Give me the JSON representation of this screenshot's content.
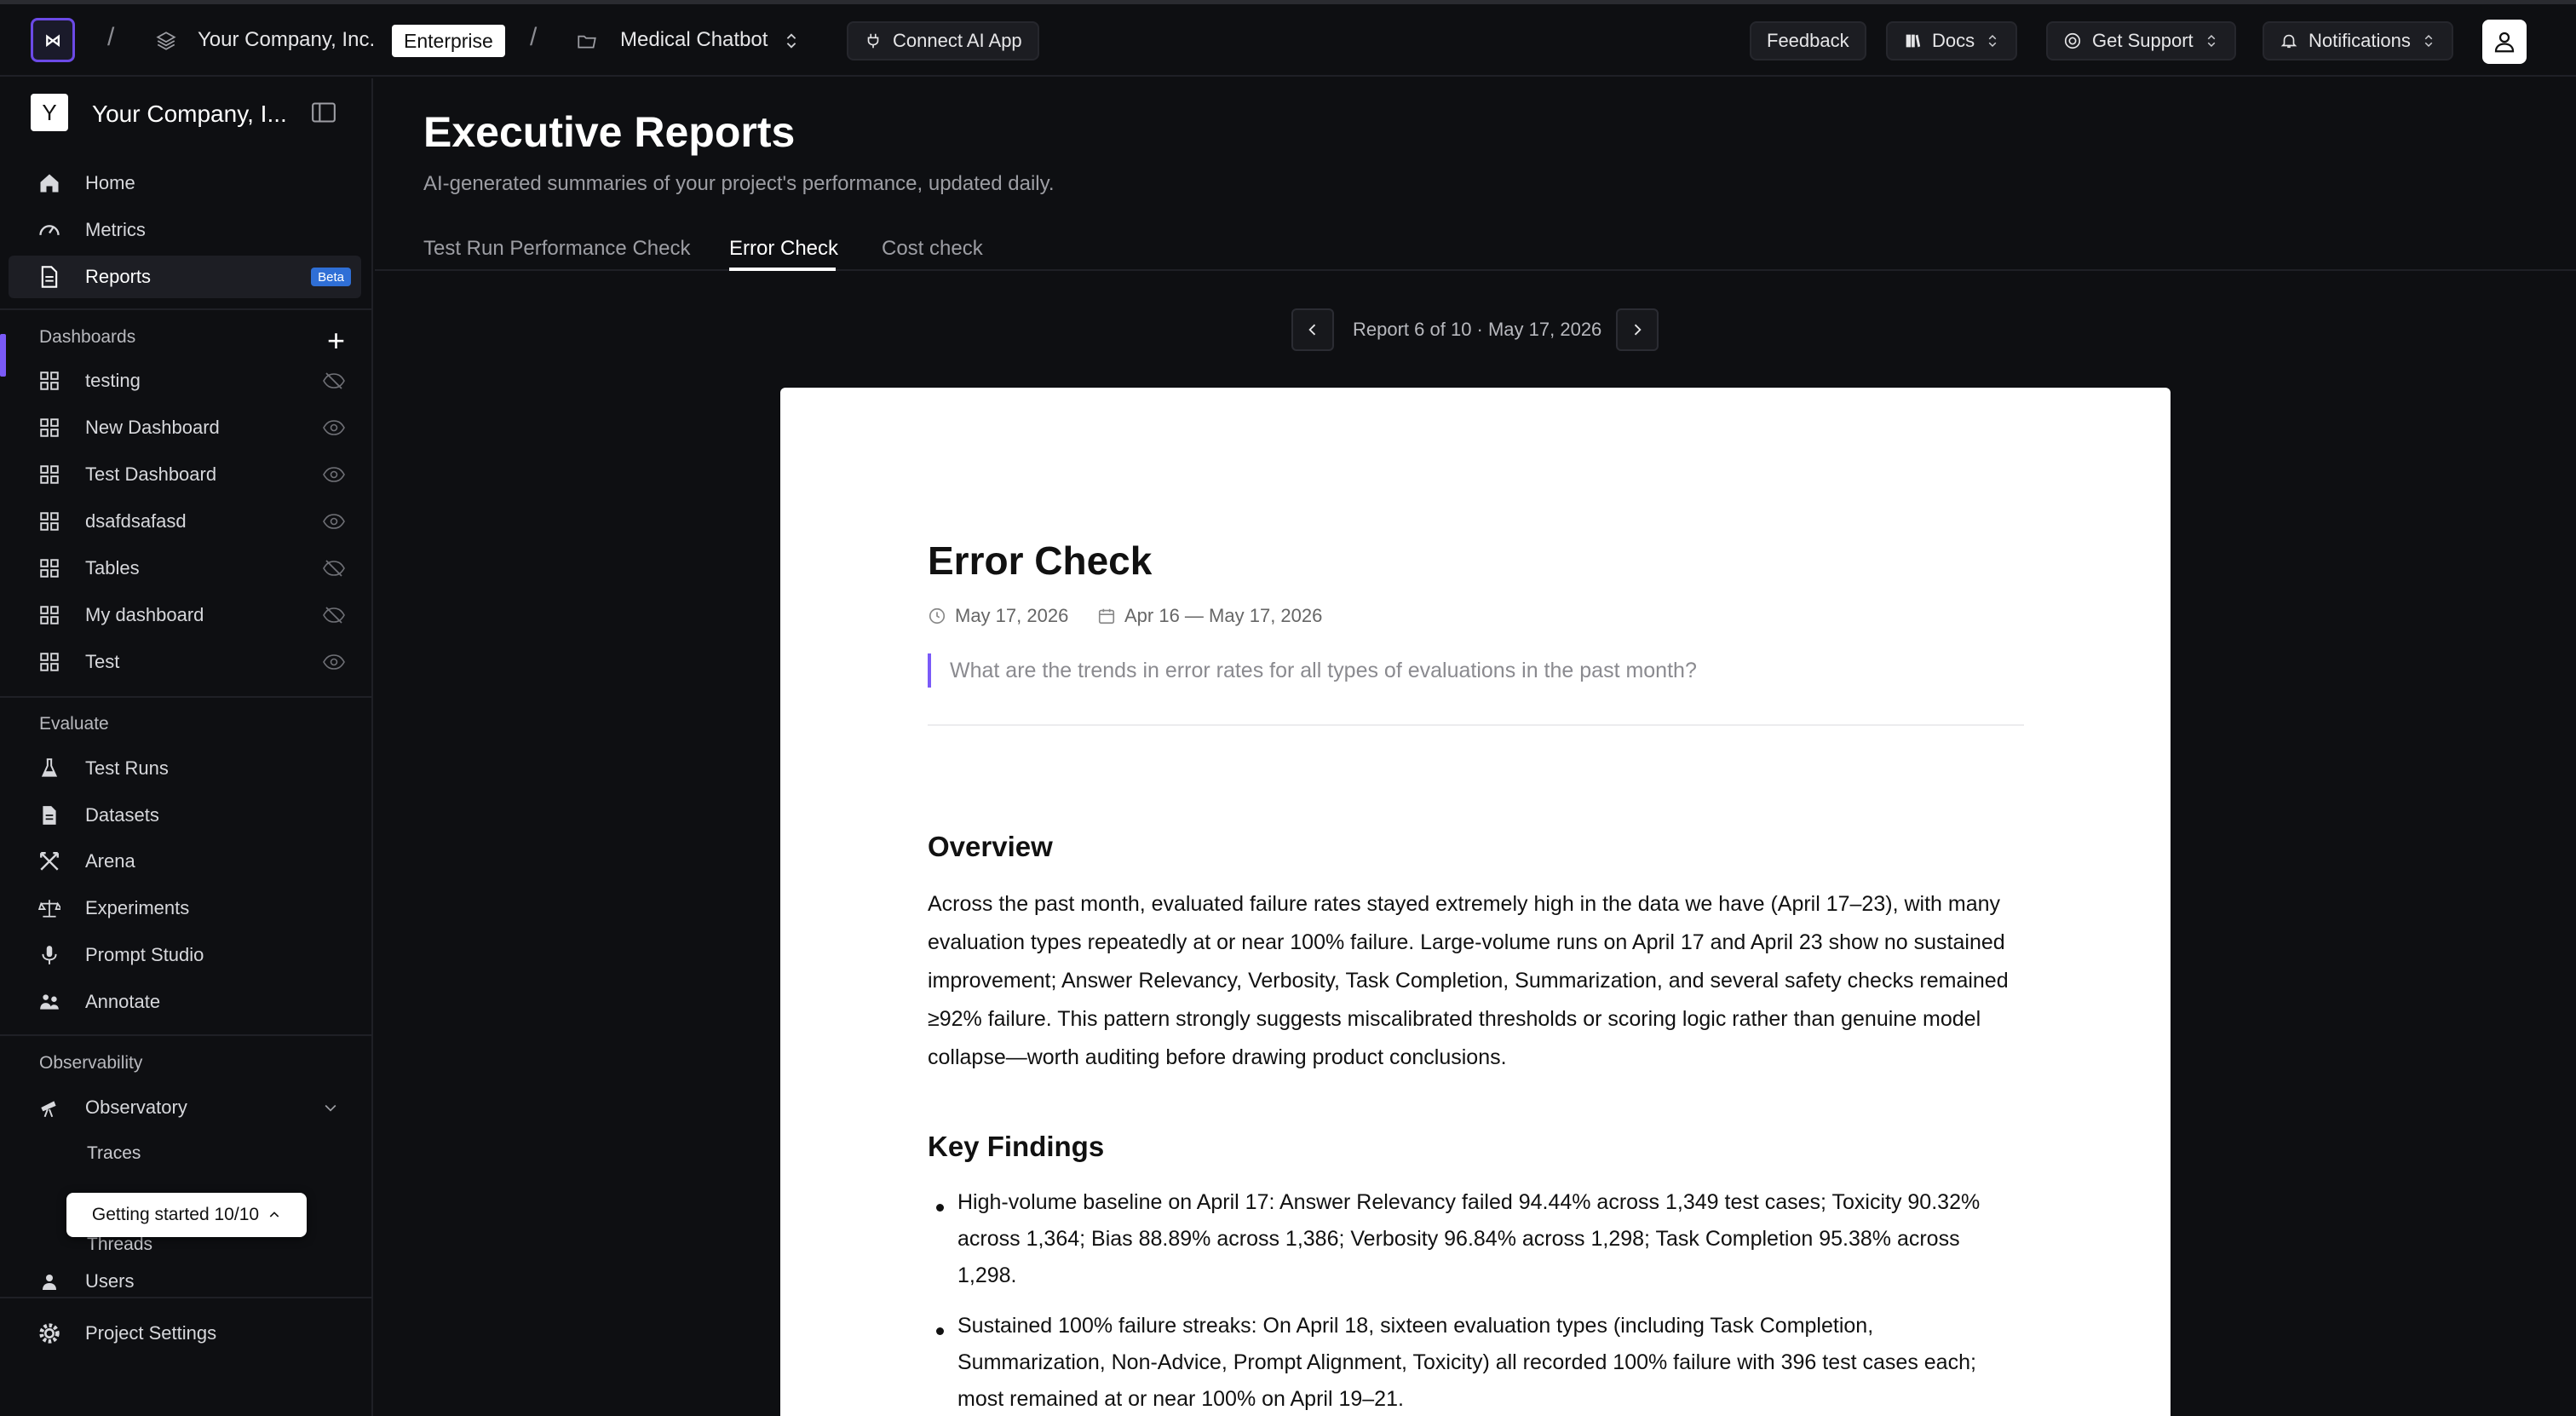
{
  "topbar": {
    "logo_text": "⋈",
    "org_name": "Your Company, Inc.",
    "plan_badge": "Enterprise",
    "project_name": "Medical Chatbot",
    "connect_label": "Connect AI App",
    "feedback_label": "Feedback",
    "docs_label": "Docs",
    "support_label": "Get Support",
    "notifications_label": "Notifications"
  },
  "sidebar": {
    "workspace_initial": "Y",
    "workspace_name": "Your Company, I...",
    "main_items": [
      {
        "label": "Home",
        "icon": "home-icon"
      },
      {
        "label": "Metrics",
        "icon": "gauge-icon"
      },
      {
        "label": "Reports",
        "icon": "document-icon",
        "badge": "Beta"
      }
    ],
    "dashboards_label": "Dashboards",
    "dashboards": [
      {
        "label": "testing",
        "visibility": "hidden"
      },
      {
        "label": "New Dashboard",
        "visibility": "visible"
      },
      {
        "label": "Test Dashboard",
        "visibility": "visible"
      },
      {
        "label": "dsafdsafasd",
        "visibility": "visible"
      },
      {
        "label": "Tables",
        "visibility": "hidden"
      },
      {
        "label": "My dashboard",
        "visibility": "hidden"
      },
      {
        "label": "Test",
        "visibility": "visible"
      }
    ],
    "evaluate_label": "Evaluate",
    "evaluate_items": [
      {
        "label": "Test Runs",
        "icon": "flask-icon"
      },
      {
        "label": "Datasets",
        "icon": "file-icon"
      },
      {
        "label": "Arena",
        "icon": "swords-icon"
      },
      {
        "label": "Experiments",
        "icon": "scale-icon"
      },
      {
        "label": "Prompt Studio",
        "icon": "mic-icon"
      },
      {
        "label": "Annotate",
        "icon": "users-icon"
      }
    ],
    "observability_label": "Observability",
    "observatory_label": "Observatory",
    "observatory_sub": [
      "Traces",
      "Threads",
      "Users"
    ],
    "getting_started": "Getting started 10/10",
    "settings_label": "Project Settings"
  },
  "main": {
    "title": "Executive Reports",
    "subtitle": "AI-generated summaries of your project's performance, updated daily.",
    "tabs": [
      {
        "label": "Test Run Performance Check"
      },
      {
        "label": "Error Check"
      },
      {
        "label": "Cost check"
      }
    ],
    "pager_text": "Report 6 of 10 · May 17, 2026"
  },
  "report": {
    "title": "Error Check",
    "date": "May 17, 2026",
    "range": "Apr 16 — May 17, 2026",
    "question": "What are the trends in error rates for all types of evaluations in the past month?",
    "overview_heading": "Overview",
    "overview_text": "Across the past month, evaluated failure rates stayed extremely high in the data we have (April 17–23), with many evaluation types repeatedly at or near 100% failure. Large-volume runs on April 17 and April 23 show no sustained improvement; Answer Relevancy, Verbosity, Task Completion, Summarization, and several safety checks remained ≥92% failure. This pattern strongly suggests miscalibrated thresholds or scoring logic rather than genuine model collapse—worth auditing before drawing product conclusions.",
    "findings_heading": "Key Findings",
    "findings": [
      "High-volume baseline on April 17: Answer Relevancy failed 94.44% across 1,349 test cases; Toxicity 90.32% across 1,364; Bias 88.89% across 1,386; Verbosity 96.84% across 1,298; Task Completion 95.38% across 1,298.",
      "Sustained 100% failure streaks: On April 18, sixteen evaluation types (including Task Completion, Summarization, Non-Advice, Prompt Alignment, Toxicity) all recorded 100% failure with 396 test cases each; most remained at or near 100% on April 19–21."
    ]
  }
}
